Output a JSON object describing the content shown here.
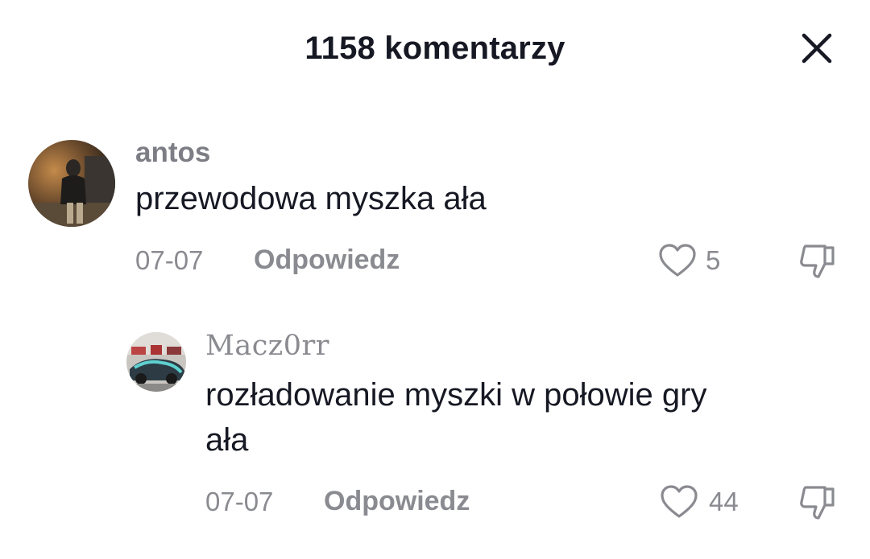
{
  "header": {
    "title": "1158 komentarzy"
  },
  "comments": [
    {
      "username": "antos",
      "text": "przewodowa myszka ała",
      "date": "07-07",
      "reply_label": "Odpowiedz",
      "likes": "5"
    },
    {
      "username": "Macz0rr",
      "text_lines": [
        "rozładowanie myszki w połowie gry",
        "ała"
      ],
      "date": "07-07",
      "reply_label": "Odpowiedz",
      "likes": "44"
    }
  ],
  "colors": {
    "primary_text": "#161823",
    "secondary_text": "#8a8b91",
    "background": "#ffffff"
  },
  "icons": [
    "close-icon",
    "heart-icon",
    "dislike-icon"
  ]
}
